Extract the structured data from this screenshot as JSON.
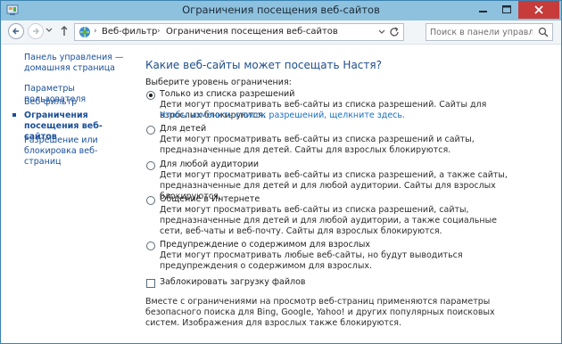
{
  "window": {
    "title": "Ограничения посещения веб-сайтов"
  },
  "address": {
    "crumbs": [
      "Веб-фильтр",
      "Ограничения посещения веб-сайтов"
    ]
  },
  "search": {
    "placeholder": "Поиск в панели управления"
  },
  "sidebar": {
    "home_link": "Панель управления — домашняя страница",
    "items": [
      {
        "label": "Параметры пользователя",
        "active": false
      },
      {
        "label": "Веб-фильтр",
        "active": false
      },
      {
        "label": "Ограничения посещения веб-сайтов",
        "active": true
      },
      {
        "label": "Разрешение или блокировка веб-страниц",
        "active": false
      }
    ]
  },
  "main": {
    "heading": "Какие веб-сайты может посещать Настя?",
    "prompt": "Выберите уровень ограничения:",
    "options": [
      {
        "label": "Только из списка разрешений",
        "desc": "Дети могут просматривать веб-сайты из списка разрешений. Сайты для взрослых блокируются.",
        "link": "Чтобы изменить список разрешений, щелкните здесь.",
        "checked": true
      },
      {
        "label": "Для детей",
        "desc": "Дети могут просматривать веб-сайты из списка разрешений и сайты, предназначенные для детей. Сайты для взрослых блокируются.",
        "checked": false
      },
      {
        "label": "Для любой аудитории",
        "desc": "Дети могут просматривать веб-сайты из списка разрешений, а также сайты, предназначенные для детей и для любой аудитории. Сайты для взрослых блокируются.",
        "checked": false
      },
      {
        "label": "Общение в Интернете",
        "desc": "Дети могут просматривать веб-сайты из списка разрешений, сайты, предназначенные для детей и для любой аудитории, а также социальные сети, веб-чаты и веб-почту. Сайты для взрослых блокируются.",
        "checked": false
      },
      {
        "label": "Предупреждение о содержимом для взрослых",
        "desc": "Дети могут просматривать любые веб-сайты, но будут выводиться предупреждения о содержимом для взрослых.",
        "checked": false
      }
    ],
    "block_downloads": {
      "label": "Заблокировать загрузку файлов",
      "checked": false
    },
    "note": "Вместе с ограничениями на просмотр веб-страниц применяются параметры безопасного поиска для Bing, Google, Yahoo! и других популярных поисковых систем. Изображения для взрослых также блокируются."
  },
  "icons": [
    "app-icon",
    "minimize-icon",
    "maximize-icon",
    "close-icon",
    "back-arrow-icon",
    "forward-arrow-icon",
    "recent-pages-icon",
    "up-arrow-icon",
    "control-panel-icon",
    "address-dropdown-icon",
    "refresh-icon",
    "search-icon"
  ],
  "colors": {
    "titlebar": "#8ec1dd",
    "close": "#c73b3b",
    "link": "#1a4f99",
    "heading": "#1e4e8c"
  }
}
